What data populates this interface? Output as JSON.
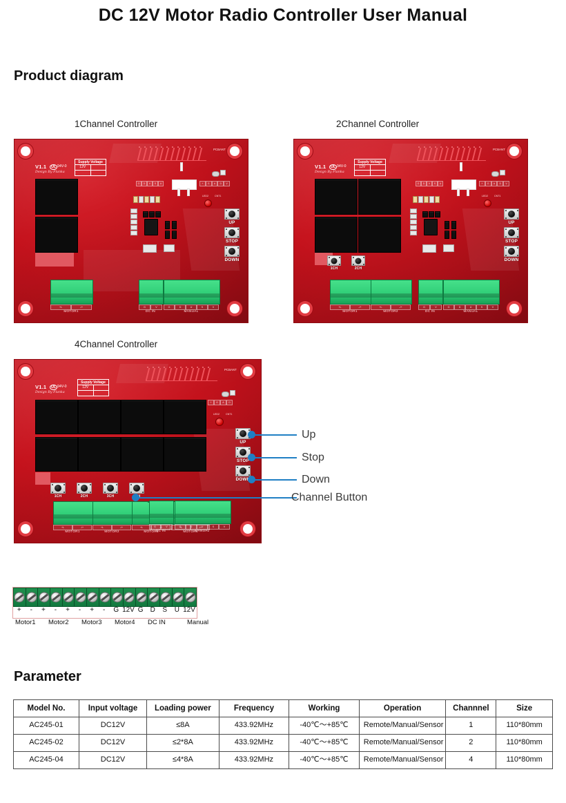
{
  "document": {
    "title": "DC 12V Motor Radio Controller User Manual"
  },
  "sections": {
    "product_diagram": "Product diagram",
    "parameter": "Parameter"
  },
  "boards": [
    {
      "caption": "1Channel Controller",
      "silk": {
        "version": "V1.1",
        "ul_mark": "UL",
        "flame_rating": "94V-0",
        "designer": "Design By Flanka",
        "supply_header": "Supply Voltage",
        "supply_value": "12V",
        "pcb_ant": "PCBANT",
        "led_ref": "LED2",
        "led_net": "CNT1"
      },
      "connectors": [
        {
          "name": "MOTOR1",
          "pins": [
            "+L",
            "-/+"
          ]
        },
        {
          "name": "DC IN",
          "pins": [
            "G",
            "V"
          ]
        },
        {
          "name": "MANUAL",
          "pins": [
            "G",
            "D",
            "U",
            "S",
            "V"
          ]
        }
      ],
      "buttons": [
        "UP",
        "STOP",
        "DOWN"
      ],
      "channel_buttons": []
    },
    {
      "caption": "2Channel Controller",
      "silk": {
        "version": "V1.1",
        "ul_mark": "UL",
        "flame_rating": "94V-0",
        "designer": "Design By Flanka",
        "supply_header": "Supply Voltage",
        "supply_value": "12V",
        "pcb_ant": "PCBANT",
        "led_ref": "LED2",
        "led_net": "CNT1"
      },
      "connectors": [
        {
          "name": "MOTOR1",
          "pins": [
            "+L",
            "-/+"
          ]
        },
        {
          "name": "MOTOR2",
          "pins": [
            "+L",
            "-/+"
          ]
        },
        {
          "name": "DC IN",
          "pins": [
            "G",
            "V"
          ]
        },
        {
          "name": "MANUAL",
          "pins": [
            "G",
            "D",
            "U",
            "S",
            "V"
          ]
        }
      ],
      "buttons": [
        "UP",
        "STOP",
        "DOWN"
      ],
      "channel_buttons": [
        "1CH",
        "2CH"
      ]
    },
    {
      "caption": "4Channel Controller",
      "silk": {
        "version": "V1.1",
        "ul_mark": "UL",
        "flame_rating": "94V-0",
        "designer": "Design By Flanka",
        "supply_header": "Supply Voltage",
        "supply_value": "12V",
        "pcb_ant": "PCBANT",
        "led_ref": "LED2",
        "led_net": "CNT1"
      },
      "connectors": [
        {
          "name": "MOTOR1",
          "pins": [
            "+L",
            "-/+"
          ]
        },
        {
          "name": "MOTOR2",
          "pins": [
            "+L",
            "-/+"
          ]
        },
        {
          "name": "MOTOR3",
          "pins": [
            "+L",
            "-/+"
          ]
        },
        {
          "name": "MOTOR4",
          "pins": [
            "+L",
            "-/+"
          ]
        },
        {
          "name": "DC IN",
          "pins": [
            "G",
            "V"
          ]
        },
        {
          "name": "MANUAL",
          "pins": [
            "G",
            "D",
            "U",
            "S",
            "V"
          ]
        }
      ],
      "buttons": [
        "UP",
        "STOP",
        "DOWN"
      ],
      "channel_buttons": [
        "1CH",
        "2CH",
        "3CH",
        "4CH"
      ]
    }
  ],
  "callouts": [
    {
      "label": "Up"
    },
    {
      "label": "Stop"
    },
    {
      "label": "Down"
    },
    {
      "label": "Channel Button"
    }
  ],
  "terminal_strip": {
    "pins": [
      "+",
      "-",
      "+",
      "-",
      "+",
      "-",
      "+",
      "-",
      "G",
      "12V",
      "G",
      "D",
      "S",
      "U",
      "12V"
    ],
    "groups": [
      "Motor1",
      "Motor2",
      "Motor3",
      "Motor4",
      "DC IN",
      "Manual"
    ]
  },
  "parameter_table": {
    "headers": [
      "Model No.",
      "Input voltage",
      "Loading power",
      "Frequency",
      "Working",
      "Operation",
      "Channnel",
      "Size"
    ],
    "rows": [
      {
        "model": "AC245-01",
        "input_voltage": "DC12V",
        "loading_power": "≤8A",
        "frequency": "433.92MHz",
        "working": "-40℃～+85℃",
        "operation": "Remote/Manual/Sensor",
        "channel": "1",
        "size": "110*80mm"
      },
      {
        "model": "AC245-02",
        "input_voltage": "DC12V",
        "loading_power": "≤2*8A",
        "frequency": "433.92MHz",
        "working": "-40℃～+85℃",
        "operation": "Remote/Manual/Sensor",
        "channel": "2",
        "size": "110*80mm"
      },
      {
        "model": "AC245-04",
        "input_voltage": "DC12V",
        "loading_power": "≤4*8A",
        "frequency": "433.92MHz",
        "working": "-40℃～+85℃",
        "operation": "Remote/Manual/Sensor",
        "channel": "4",
        "size": "110*80mm"
      }
    ]
  },
  "colors": {
    "pcb_red": "#c4121c",
    "callout_blue": "#1f7fc4",
    "terminal_green": "#17a257",
    "strip_green": "#12793f"
  }
}
